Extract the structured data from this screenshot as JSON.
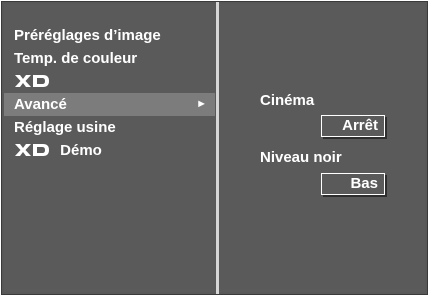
{
  "menu": {
    "items": [
      {
        "label": "Préréglages d’image"
      },
      {
        "label": "Temp. de couleur"
      },
      {
        "logo": "XD"
      },
      {
        "label": "Avancé",
        "arrow": "►"
      },
      {
        "label": "Réglage usine"
      },
      {
        "logo": "XD",
        "label": "Démo"
      }
    ]
  },
  "advanced": {
    "cinema": {
      "label": "Cinéma",
      "value": "Arrêt"
    },
    "black_level": {
      "label": "Niveau noir",
      "value": "Bas"
    }
  },
  "colors": {
    "panel": "#5a5a5a",
    "selected": "#7c7c7c",
    "divider": "#d6d6d6",
    "text": "#ffffff"
  },
  "icons": {
    "xd_logo": "xd-logo-icon",
    "submenu_arrow": "right-arrow-icon"
  }
}
